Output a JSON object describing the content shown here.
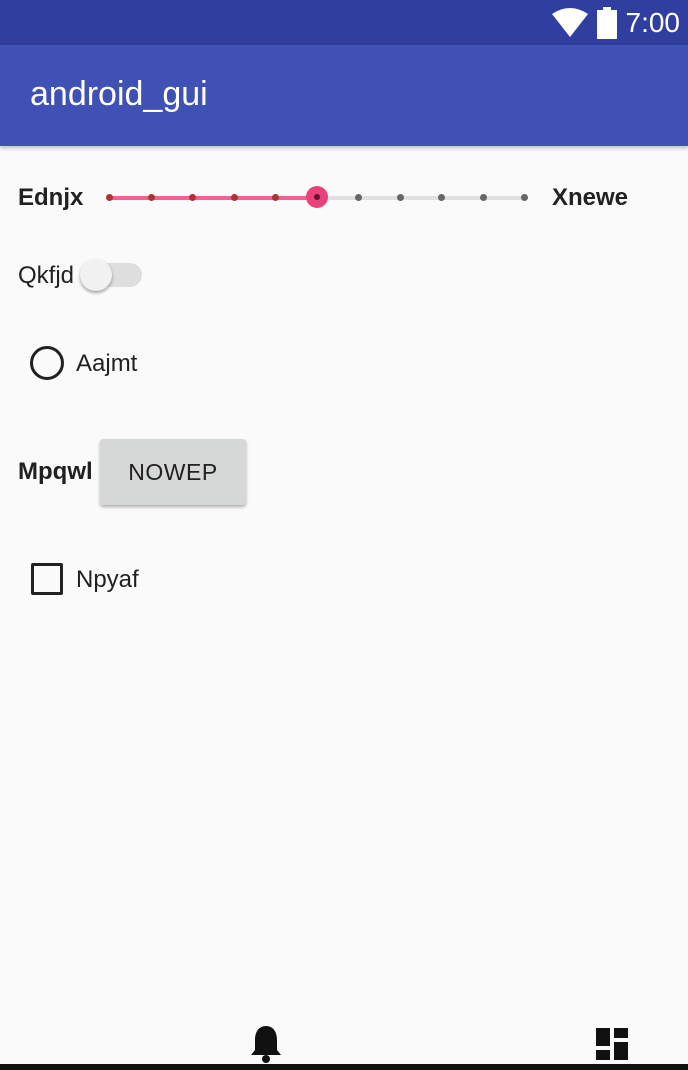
{
  "status_bar": {
    "time": "7:00",
    "icons": [
      "wifi-icon",
      "battery-icon"
    ]
  },
  "app_bar": {
    "title": "android_gui"
  },
  "slider": {
    "left_label": "Ednjx",
    "right_label": "Xnewe",
    "steps": 10,
    "value": 5,
    "accent": "#ec407a"
  },
  "switch": {
    "label": "Qkfjd",
    "checked": false
  },
  "radio": {
    "label": "Aajmt",
    "checked": false
  },
  "button_row": {
    "label": "Mpqwl",
    "button_label": "NOWEP"
  },
  "checkbox": {
    "label": "Npyaf",
    "checked": false
  },
  "bottom_nav": {
    "icons": [
      "bell-icon",
      "dashboard-icon"
    ]
  },
  "colors": {
    "primary": "#3f51b5",
    "primary_dark": "#303f9f",
    "accent": "#ec407a"
  }
}
